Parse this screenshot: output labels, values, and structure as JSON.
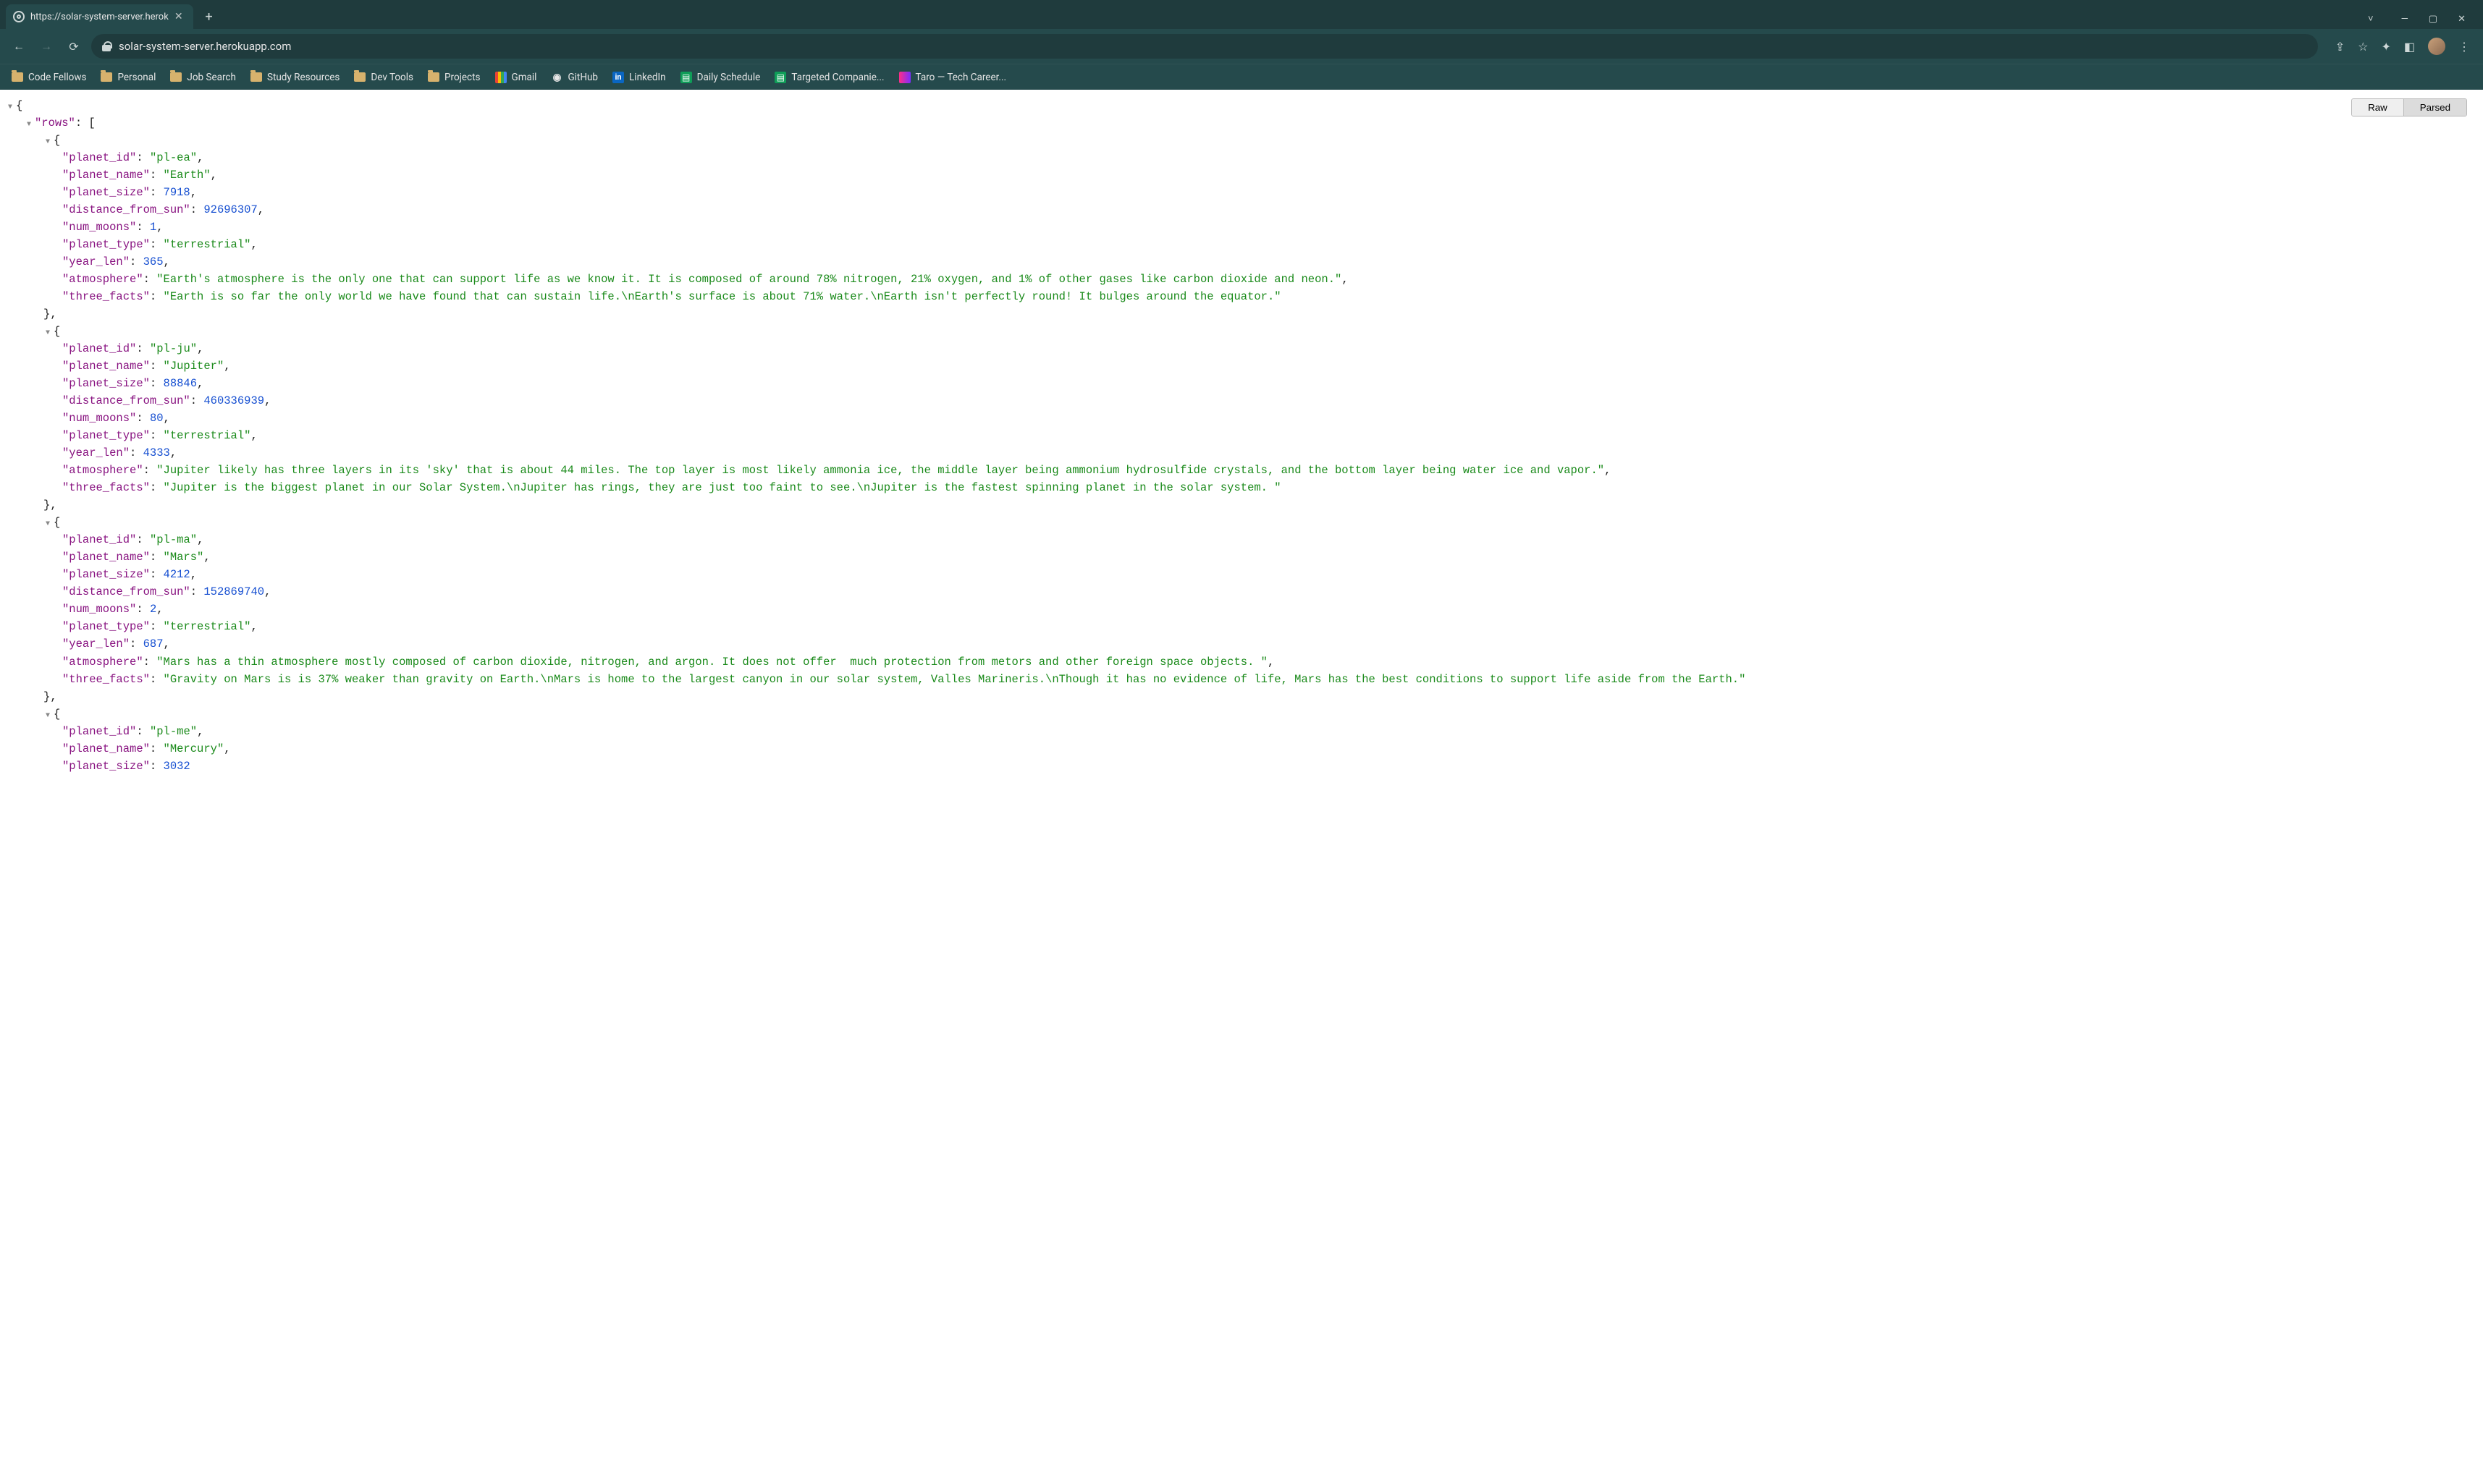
{
  "browser": {
    "tabs": [
      {
        "title": "https://solar-system-server.herok",
        "active": true
      }
    ],
    "url_display": "solar-system-server.herokuapp.com",
    "window_buttons": {
      "chevron": "˅",
      "minimize": "—",
      "maximize": "▢",
      "close": "✕"
    }
  },
  "bookmarks": [
    {
      "label": "Code Fellows",
      "icon": "folder"
    },
    {
      "label": "Personal",
      "icon": "folder"
    },
    {
      "label": "Job Search",
      "icon": "folder"
    },
    {
      "label": "Study Resources",
      "icon": "folder"
    },
    {
      "label": "Dev Tools",
      "icon": "folder"
    },
    {
      "label": "Projects",
      "icon": "folder"
    },
    {
      "label": "Gmail",
      "icon": "gmail"
    },
    {
      "label": "GitHub",
      "icon": "github"
    },
    {
      "label": "LinkedIn",
      "icon": "linkedin"
    },
    {
      "label": "Daily Schedule",
      "icon": "sheet"
    },
    {
      "label": "Targeted Companie...",
      "icon": "sheet"
    },
    {
      "label": "Taro — Tech Career...",
      "icon": "taro"
    }
  ],
  "view_toggle": {
    "raw": "Raw",
    "parsed": "Parsed",
    "active": "Parsed"
  },
  "json_payload": {
    "rows": [
      {
        "planet_id": "pl-ea",
        "planet_name": "Earth",
        "planet_size": 7918,
        "distance_from_sun": 92696307,
        "num_moons": 1,
        "planet_type": "terrestrial",
        "year_len": 365,
        "atmosphere": "Earth's atmosphere is the only one that can support life as we know it. It is composed of around 78% nitrogen, 21% oxygen, and 1% of other gases like carbon dioxide and neon.",
        "three_facts": "Earth is so far the only world we have found that can sustain life.\\nEarth's surface is about 71% water.\\nEarth isn't perfectly round! It bulges around the equator."
      },
      {
        "planet_id": "pl-ju",
        "planet_name": "Jupiter",
        "planet_size": 88846,
        "distance_from_sun": 460336939,
        "num_moons": 80,
        "planet_type": "terrestrial",
        "year_len": 4333,
        "atmosphere": "Jupiter likely has three layers in its 'sky' that is about 44 miles. The top layer is most likely ammonia ice, the middle layer being ammonium hydrosulfide crystals, and the bottom layer being water ice and vapor.",
        "three_facts": "Jupiter is the biggest planet in our Solar System.\\nJupiter has rings, they are just too faint to see.\\nJupiter is the fastest spinning planet in the solar system. "
      },
      {
        "planet_id": "pl-ma",
        "planet_name": "Mars",
        "planet_size": 4212,
        "distance_from_sun": 152869740,
        "num_moons": 2,
        "planet_type": "terrestrial",
        "year_len": 687,
        "atmosphere": "Mars has a thin atmosphere mostly composed of carbon dioxide, nitrogen, and argon. It does not offer  much protection from metors and other foreign space objects. ",
        "three_facts": "Gravity on Mars is is 37% weaker than gravity on Earth.\\nMars is home to the largest canyon in our solar system, Valles Marineris.\\nThough it has no evidence of life, Mars has the best conditions to support life aside from the Earth."
      },
      {
        "planet_id": "pl-me",
        "planet_name": "Mercury",
        "planet_size": 3032
      }
    ]
  },
  "json_keys": {
    "rows": "rows",
    "planet_id": "planet_id",
    "planet_name": "planet_name",
    "planet_size": "planet_size",
    "distance_from_sun": "distance_from_sun",
    "num_moons": "num_moons",
    "planet_type": "planet_type",
    "year_len": "year_len",
    "atmosphere": "atmosphere",
    "three_facts": "three_facts"
  }
}
